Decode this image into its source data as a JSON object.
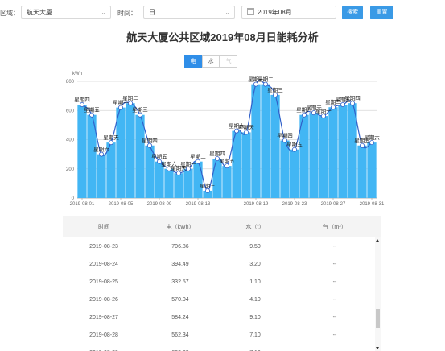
{
  "filters": {
    "area_label": "区域：",
    "area_value": "航天大厦",
    "time_label": "时间：",
    "time_value": "日",
    "date_value": "2019年08月",
    "search_label": "搜索",
    "reset_label": "重置"
  },
  "tabs": [
    {
      "label": "电",
      "state": "active"
    },
    {
      "label": "水",
      "state": "normal"
    },
    {
      "label": "气",
      "state": "disabled"
    }
  ],
  "colors": {
    "accent": "#2f8ee8",
    "bar": "#42b6f4",
    "line": "#3160c9"
  },
  "chart_data": {
    "type": "bar",
    "title": "航天大厦公共区域2019年08月日能耗分析",
    "ylabel": "kWh",
    "ylim": [
      0,
      800
    ],
    "yticks": [
      0,
      200,
      400,
      600,
      800
    ],
    "xticks": [
      "2019-08-01",
      "2019-08-05",
      "2019-08-09",
      "2019-08-13",
      "2019-08-19",
      "2019-08-23",
      "2019-08-27",
      "2019-08-31"
    ],
    "grid": true,
    "categories": [
      "2019-08-01",
      "2019-08-02",
      "2019-08-03",
      "2019-08-04",
      "2019-08-05",
      "2019-08-06",
      "2019-08-07",
      "2019-08-08",
      "2019-08-09",
      "2019-08-10",
      "2019-08-11",
      "2019-08-12",
      "2019-08-13",
      "2019-08-14",
      "2019-08-15",
      "2019-08-16",
      "2019-08-17",
      "2019-08-18",
      "2019-08-19",
      "2019-08-20",
      "2019-08-21",
      "2019-08-22",
      "2019-08-23",
      "2019-08-24",
      "2019-08-25",
      "2019-08-26",
      "2019-08-27",
      "2019-08-28",
      "2019-08-29",
      "2019-08-30",
      "2019-08-31"
    ],
    "values": [
      640,
      570,
      300,
      380,
      620,
      650,
      570,
      360,
      250,
      200,
      170,
      200,
      250,
      50,
      270,
      220,
      460,
      450,
      780,
      780,
      706.86,
      394.49,
      332.57,
      570.04,
      584.24,
      562.34,
      622.33,
      640,
      650,
      360,
      380
    ],
    "labels": [
      "星期四",
      "星期五",
      "星期六",
      "星期天",
      "星期一",
      "星期二",
      "星期三",
      "星期四",
      "星期五",
      "星期六",
      "星期天",
      "星期一",
      "星期二",
      "星期三",
      "星期四",
      "星期五",
      "星期六",
      "星期天",
      "星期一",
      "星期二",
      "星期三",
      "星期四",
      "星期五",
      "星期六",
      "星期天",
      "星期一",
      "星期二",
      "星期三",
      "星期四",
      "星期五",
      "星期六"
    ]
  },
  "table": {
    "headers": [
      "时间",
      "电（kWh）",
      "水（t）",
      "气（m³）"
    ],
    "rows": [
      [
        "2019-08-23",
        "706.86",
        "9.50",
        "--"
      ],
      [
        "2019-08-24",
        "394.49",
        "3.20",
        "--"
      ],
      [
        "2019-08-25",
        "332.57",
        "1.10",
        "--"
      ],
      [
        "2019-08-26",
        "570.04",
        "4.10",
        "--"
      ],
      [
        "2019-08-27",
        "584.24",
        "9.10",
        "--"
      ],
      [
        "2019-08-28",
        "562.34",
        "7.10",
        "--"
      ],
      [
        "2019-08-29",
        "622.33",
        "7.10",
        "--"
      ]
    ]
  }
}
